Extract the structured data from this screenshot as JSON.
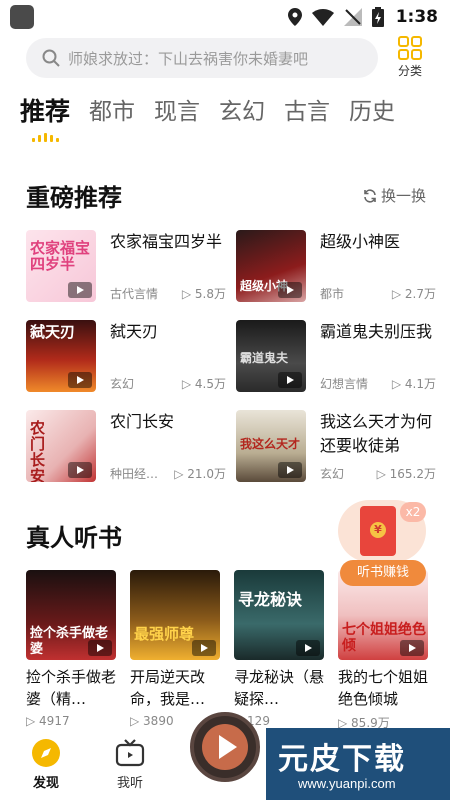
{
  "status_bar": {
    "time": "1:38"
  },
  "search": {
    "placeholder": "师娘求放过：下山去祸害你未婚妻吧",
    "category_label": "分类"
  },
  "tabs": [
    {
      "label": "推荐",
      "active": true
    },
    {
      "label": "都市"
    },
    {
      "label": "现言"
    },
    {
      "label": "玄幻"
    },
    {
      "label": "古言"
    },
    {
      "label": "历史"
    }
  ],
  "featured": {
    "title": "重磅推荐",
    "refresh_label": "换一换",
    "books": [
      {
        "title": "农家福宝四岁半",
        "genre": "古代言情",
        "plays": "5.8万",
        "cover_text": "农家福宝四岁半"
      },
      {
        "title": "超级小神医",
        "genre": "都市",
        "plays": "2.7万",
        "cover_text": "超级小神"
      },
      {
        "title": "弑天刃",
        "genre": "玄幻",
        "plays": "4.5万",
        "cover_text": "弑天刃"
      },
      {
        "title": "霸道鬼夫别压我",
        "genre": "幻想言情",
        "plays": "4.1万",
        "cover_text": "霸道鬼夫"
      },
      {
        "title": "农门长安",
        "genre": "种田经…",
        "plays": "21.0万",
        "cover_text": "农门长安"
      },
      {
        "title": "我这么天才为何还要收徒弟",
        "genre": "玄幻",
        "plays": "165.2万",
        "cover_text": "我这么天才"
      }
    ]
  },
  "audio": {
    "title": "真人听书",
    "books": [
      {
        "title": "捡个杀手做老婆（精…",
        "plays": "4917",
        "cover_text": "捡个杀手做老婆"
      },
      {
        "title": "开局逆天改命，我是…",
        "plays": "3890",
        "cover_text": "最强师尊"
      },
      {
        "title": "寻龙秘诀（悬疑探…",
        "plays": "129",
        "cover_text": "寻龙秘诀"
      },
      {
        "title": "我的七个姐姐绝色倾城",
        "plays": "85.9万",
        "cover_text": "七个姐姐绝色倾"
      }
    ]
  },
  "reward": {
    "multiplier": "x2",
    "label": "听书赚钱"
  },
  "bottom_nav": [
    {
      "label": "发现",
      "active": true
    },
    {
      "label": "我听"
    }
  ],
  "watermark": {
    "main": "元皮下载",
    "url": "www.yuanpi.com"
  },
  "colors": {
    "accent": "#f5b800",
    "text_primary": "#111111",
    "text_secondary": "#888888",
    "search_bg": "#f1f1f3"
  }
}
